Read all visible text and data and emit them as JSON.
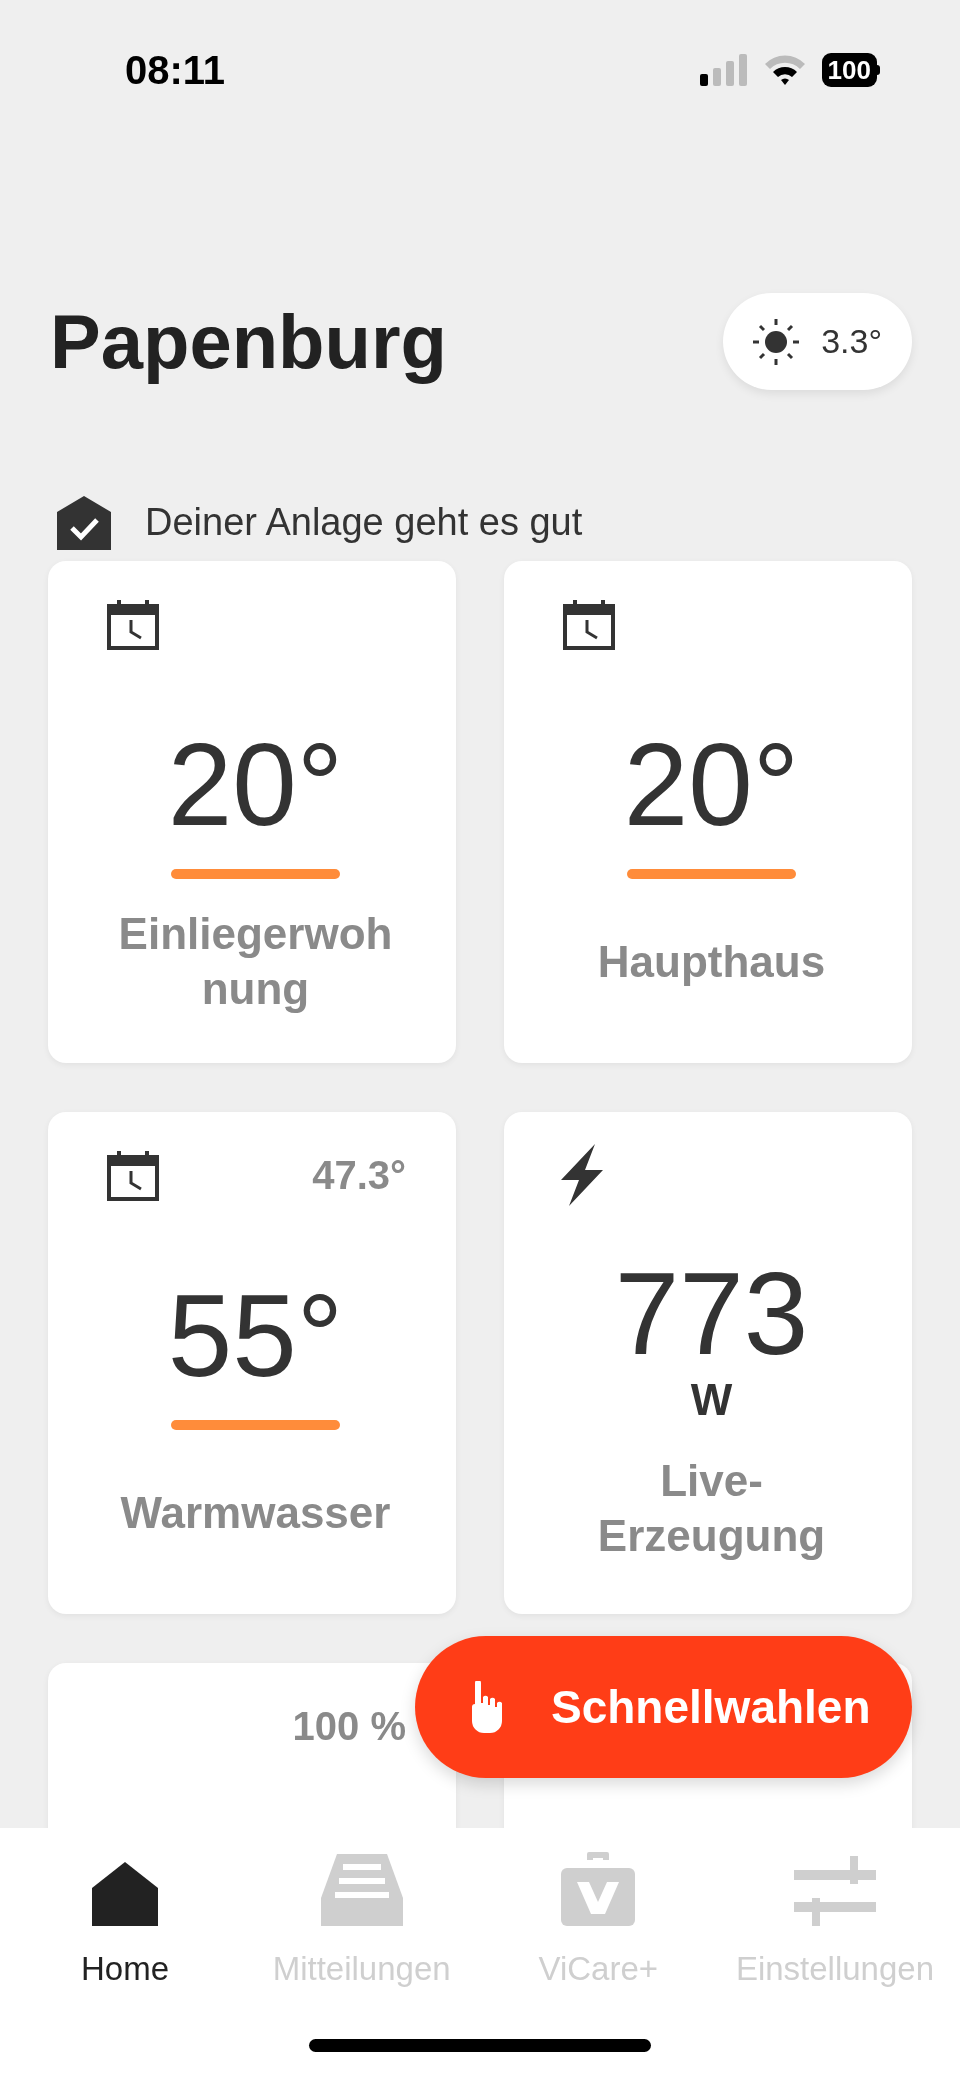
{
  "status_bar": {
    "time": "08:11",
    "battery": "100"
  },
  "header": {
    "title": "Papenburg",
    "weather": "3.3°"
  },
  "system_status": {
    "text": "Deiner Anlage geht es gut",
    "ok": true
  },
  "cards": [
    {
      "kind": "temperature",
      "value": "20°",
      "label": "Einliegerwohnung"
    },
    {
      "kind": "temperature",
      "value": "20°",
      "label": "Haupthaus"
    },
    {
      "kind": "temperature",
      "value": "55°",
      "label": "Warmwasser",
      "reading": "47.3°"
    },
    {
      "kind": "power",
      "value": "773",
      "unit": "W",
      "label": "Live-Erzeugung"
    },
    {
      "kind": "partial",
      "reading": "100 %"
    },
    {
      "kind": "partial"
    }
  ],
  "fab": {
    "label": "Schnellwahlen"
  },
  "tabs": [
    {
      "kind": "home",
      "label": "Home",
      "selected": true
    },
    {
      "kind": "messages",
      "label": "Mitteilungen",
      "selected": false
    },
    {
      "kind": "plus",
      "label": "ViCare+",
      "selected": false
    },
    {
      "kind": "settings",
      "label": "Einstellungen",
      "selected": false
    }
  ]
}
